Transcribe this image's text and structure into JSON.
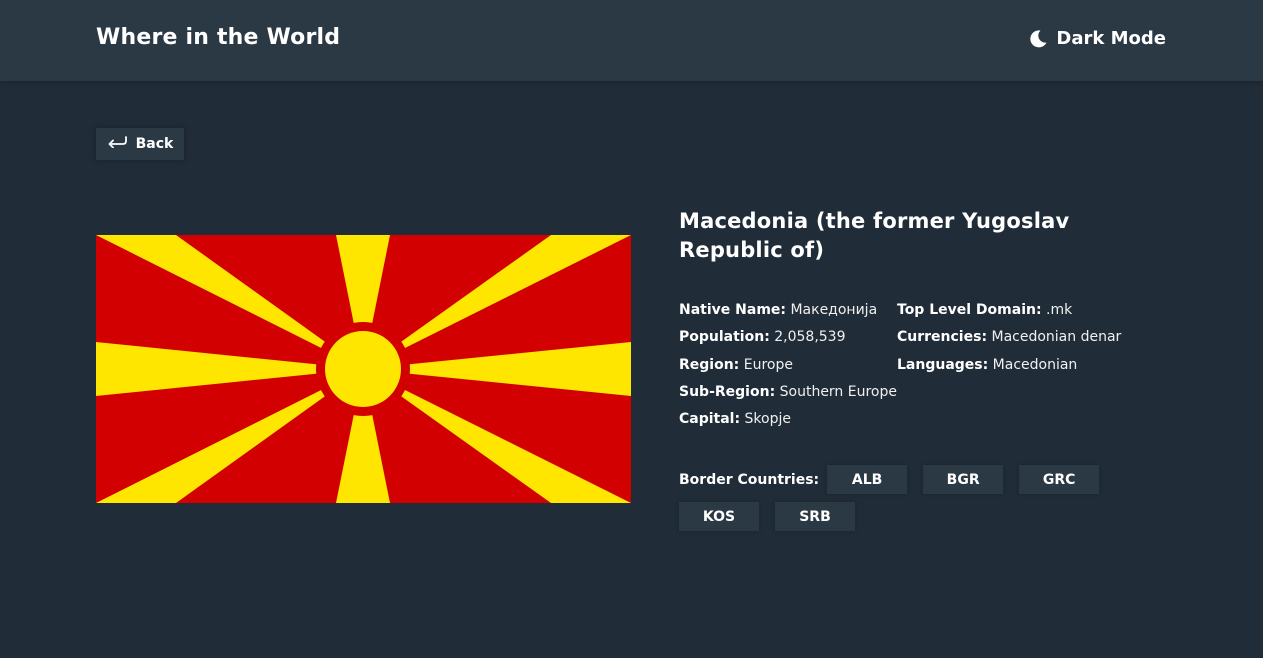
{
  "header": {
    "title": "Where in the World",
    "dark_mode_label": "Dark Mode",
    "dark_mode_icon": "moon-icon"
  },
  "back": {
    "label": "Back",
    "icon": "arrow-return-left-icon"
  },
  "country": {
    "name": "Macedonia (the former Yugoslav Republic of)",
    "flag_colors": {
      "field": "#d20000",
      "sun": "#ffe600"
    },
    "left": [
      {
        "label": "Native Name:",
        "value": "Македонија"
      },
      {
        "label": "Population:",
        "value": "2,058,539"
      },
      {
        "label": "Region:",
        "value": "Europe"
      },
      {
        "label": "Sub-Region:",
        "value": "Southern Europe"
      },
      {
        "label": "Capital:",
        "value": "Skopje"
      }
    ],
    "right": [
      {
        "label": "Top Level Domain:",
        "value": ".mk"
      },
      {
        "label": "Currencies:",
        "value": "Macedonian denar"
      },
      {
        "label": "Languages:",
        "value": "Macedonian"
      }
    ],
    "borders_label": "Border Countries:",
    "borders": [
      "ALB",
      "BGR",
      "GRC",
      "KOS",
      "SRB"
    ]
  },
  "colors": {
    "background": "#202c37",
    "surface": "#2b3945",
    "text": "#ffffff"
  }
}
